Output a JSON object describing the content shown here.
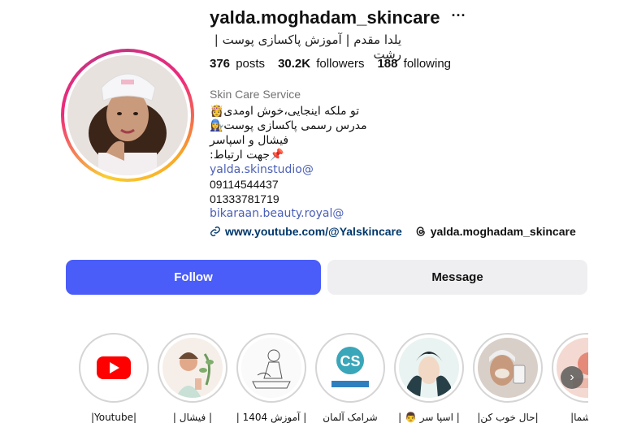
{
  "profile": {
    "username": "yalda.moghadam_skincare",
    "full_name": "یلدا مقدم | آموزش پاکسازی پوست | رشت",
    "stats": {
      "posts_count": "376",
      "posts_label": "posts",
      "followers_count": "30.2K",
      "followers_label": "followers",
      "following_count": "188",
      "following_label": "following"
    },
    "category": "Skin Care Service",
    "bio": {
      "line1": "تو ملکه اینجایی،خوش اومدی👸",
      "line2": "مدرس رسمی پاکسازی پوست👩‍🔧",
      "line3": "فیشال و اسپاسر",
      "line4": "📌جهت ارتباط:",
      "line5": "yalda.skinstudio@",
      "line6": "09114544437",
      "line7": "01333781719",
      "line8": "bikaraan.beauty.royal@"
    },
    "youtube_link": "www.youtube.com/@Yalskincare",
    "threads_handle": "yalda.moghadam_skincare"
  },
  "actions": {
    "follow_label": "Follow",
    "message_label": "Message"
  },
  "highlights": [
    {
      "label": "|Youtube|",
      "icon": "youtube-icon"
    },
    {
      "label": "| فیشال |",
      "icon": "facial-illustration"
    },
    {
      "label": "| آموزش 1404 |",
      "icon": "sketch-illustration"
    },
    {
      "label": "شرامک آلمان",
      "icon": "schrammek-logo"
    },
    {
      "label": "| اسپا سر 👨 |",
      "icon": "spa-illustration"
    },
    {
      "label": "|حال خوب کن|",
      "icon": "photo-thumbnail"
    },
    {
      "label": "ت شما|",
      "icon": "partial-thumbnail"
    }
  ],
  "colors": {
    "follow_button": "#4a5df9",
    "link": "#00376b",
    "youtube_red": "#ff0000"
  }
}
